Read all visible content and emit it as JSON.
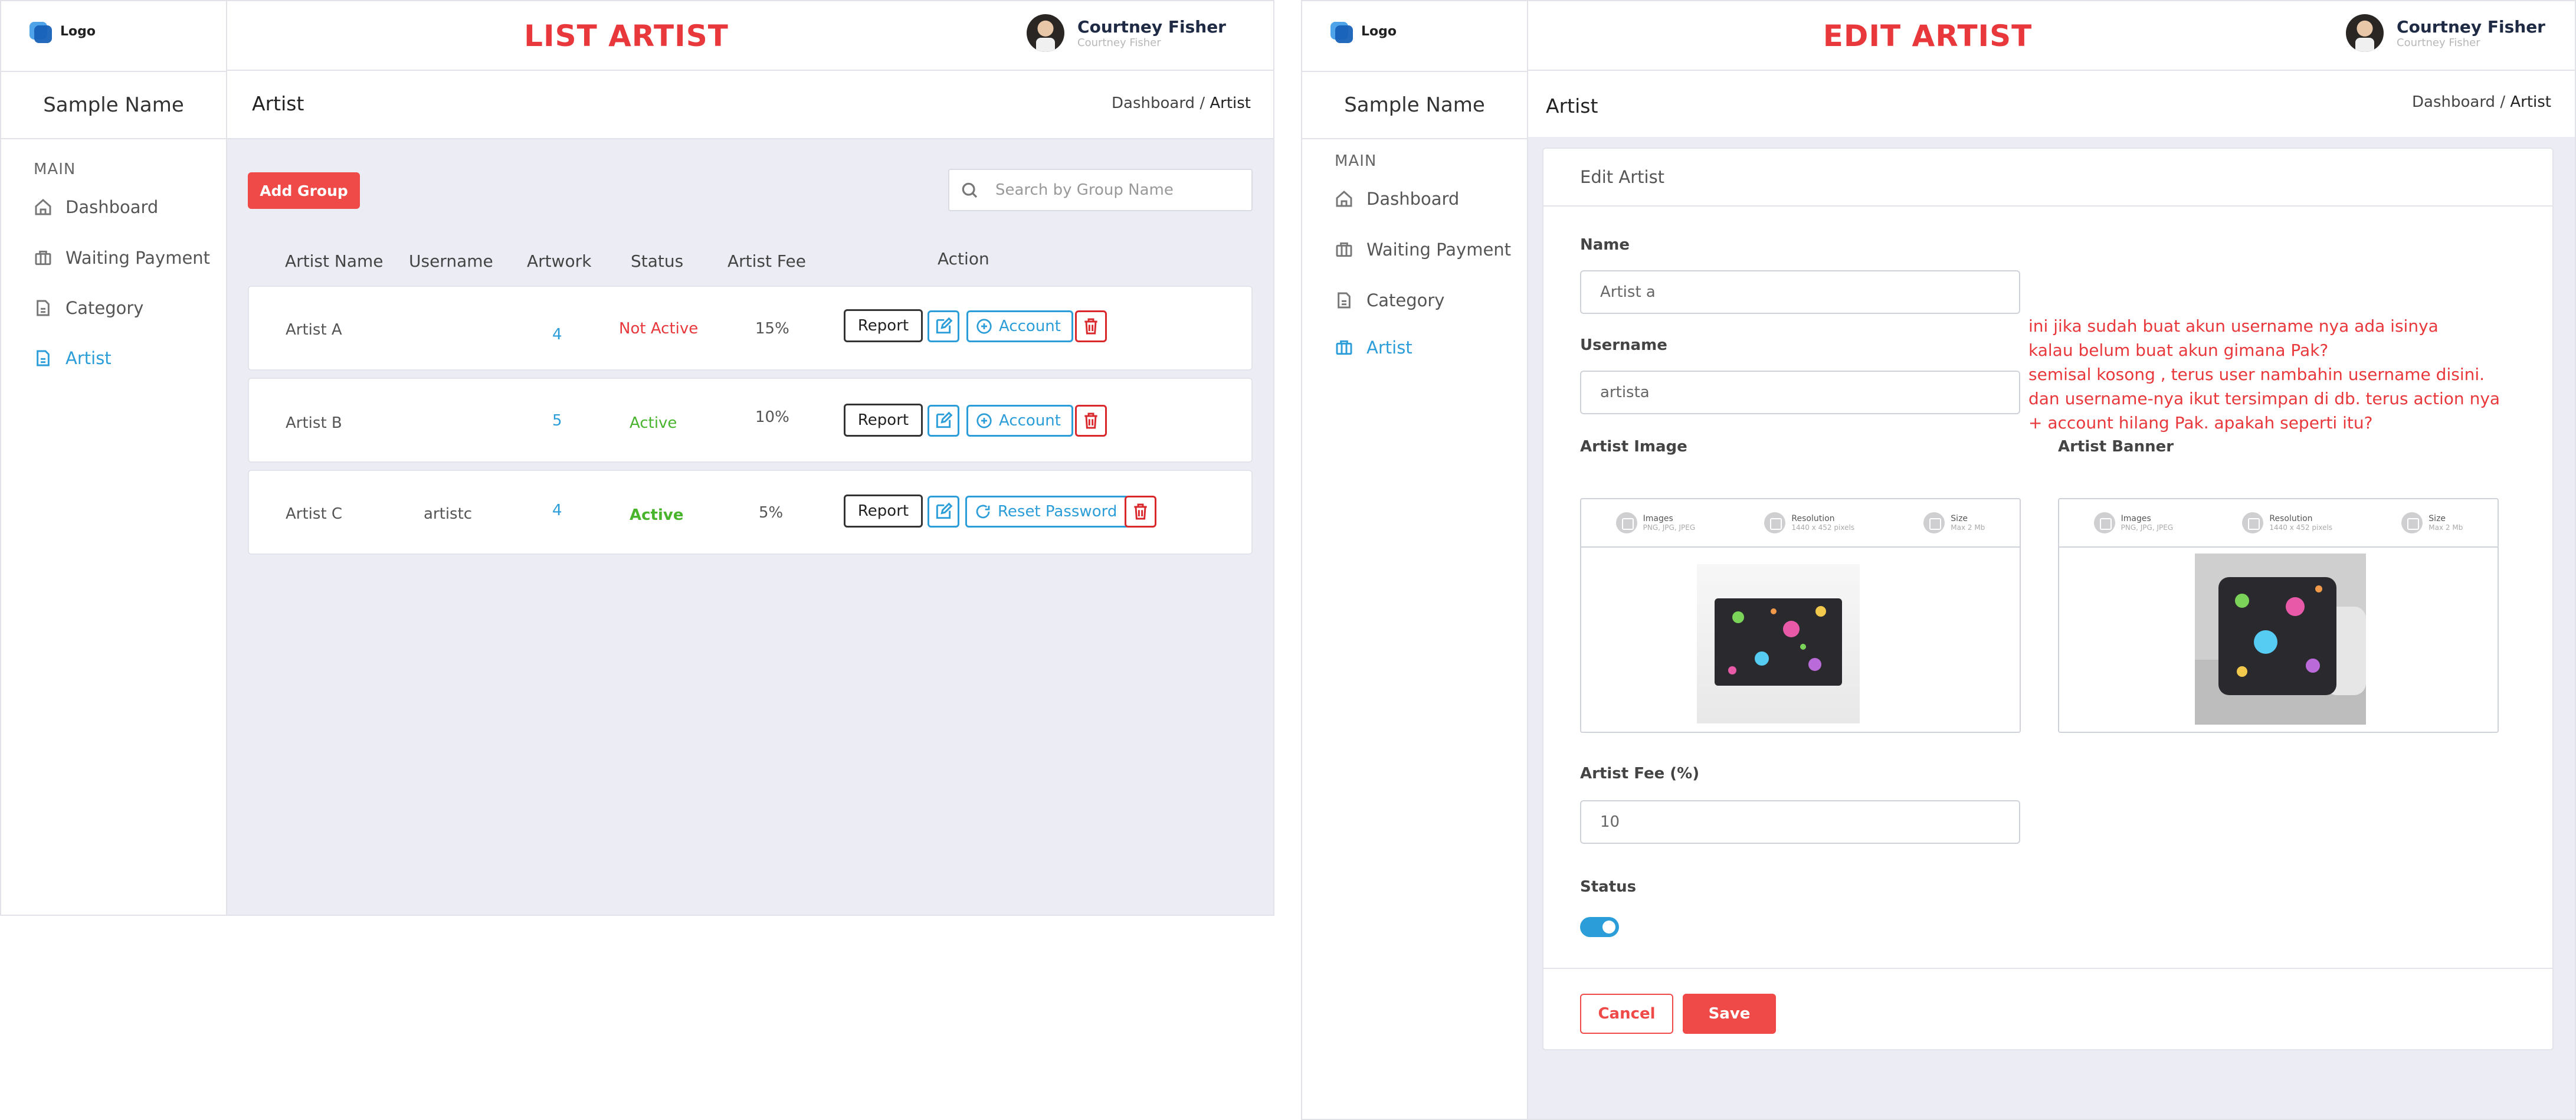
{
  "common": {
    "logo_text": "Logo",
    "sample_name": "Sample Name",
    "menu_title": "MAIN",
    "menu": [
      "Dashboard",
      "Waiting Payment",
      "Category",
      "Artist"
    ],
    "user_name": "Courtney Fisher",
    "user_sub": "Courtney Fisher",
    "crumb_parent": "Dashboard",
    "crumb_sep": "/",
    "crumb_current": "Artist",
    "section_title": "Artist"
  },
  "list": {
    "heading": "LIST ARTIST",
    "add_button": "Add Group",
    "search_placeholder": "Search by Group Name",
    "headers": [
      "Artist Name",
      "Username",
      "Artwork",
      "Status",
      "Artist Fee",
      "Action"
    ],
    "rows": [
      {
        "name": "Artist A",
        "username": "",
        "artwork": "4",
        "status": "Not Active",
        "fee": "15%",
        "action": "Account"
      },
      {
        "name": "Artist B",
        "username": "",
        "artwork": "5",
        "status": "Active",
        "fee": "10%",
        "action": "Account"
      },
      {
        "name": "Artist C",
        "username": "artistc",
        "artwork": "4",
        "status": "Active",
        "fee": "5%",
        "action": "Reset Password"
      }
    ],
    "report_label": "Report"
  },
  "edit": {
    "heading": "EDIT ARTIST",
    "card_title": "Edit Artist",
    "name_label": "Name",
    "name_value": "Artist a",
    "username_label": "Username",
    "username_value": "artista",
    "image_label": "Artist Image",
    "banner_label": "Artist Banner",
    "upload_info": [
      {
        "title": "Images",
        "sub": "PNG, JPG, JPEG"
      },
      {
        "title": "Resolution",
        "sub": "1440 x 452 pixels"
      },
      {
        "title": "Size",
        "sub": "Max 2 Mb"
      }
    ],
    "fee_label": "Artist Fee (%)",
    "fee_value": "10",
    "status_label": "Status",
    "status_on": true,
    "cancel": "Cancel",
    "save": "Save",
    "note": "ini jika sudah buat akun username nya ada isinya\nkalau belum buat akun gimana Pak?\nsemisal kosong , terus user nambahin username disini.\ndan username-nya ikut tersimpan di db. terus action nya\n+ account hilang Pak. apakah seperti itu?"
  },
  "colors": {
    "accent": "#2b9dd8",
    "danger": "#f04a48",
    "active": "#48b42c"
  }
}
